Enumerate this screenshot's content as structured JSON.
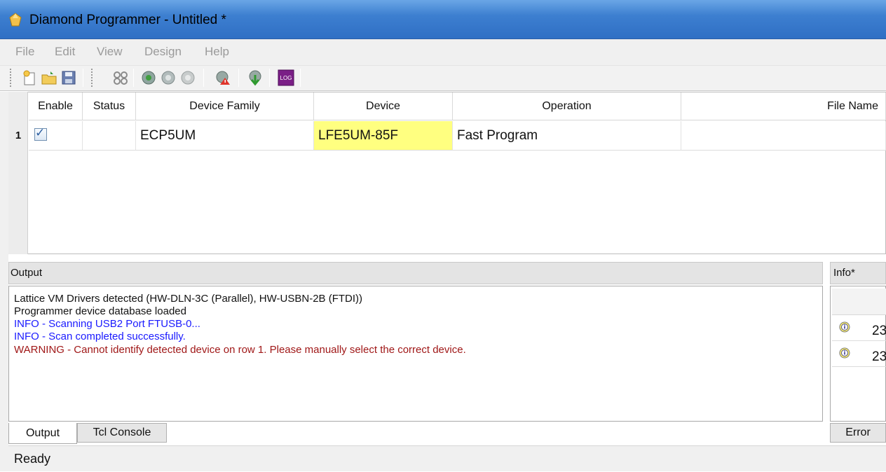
{
  "window": {
    "title": "Diamond Programmer - Untitled *"
  },
  "menu": {
    "items": [
      "File",
      "Edit",
      "View",
      "Design",
      "Help"
    ]
  },
  "toolbar": {
    "icons": [
      "new-project-icon",
      "open-project-icon",
      "save-icon",
      "scan-icon",
      "program-icon",
      "program-alt-icon",
      "program-disabled-icon",
      "cable-settings-icon",
      "download-icon",
      "log-icon"
    ],
    "log_label": "LOG"
  },
  "grid": {
    "columns": [
      "Enable",
      "Status",
      "Device Family",
      "Device",
      "Operation",
      "File Name"
    ],
    "rows": [
      {
        "num": "1",
        "enabled": true,
        "status": "",
        "family": "ECP5UM",
        "device": "LFE5UM-85F",
        "operation": "Fast Program",
        "file": ""
      }
    ]
  },
  "output": {
    "title": "Output",
    "lines": [
      {
        "text": "Lattice VM Drivers detected (HW-DLN-3C (Parallel), HW-USBN-2B (FTDI))",
        "level": "plain"
      },
      {
        "text": "Programmer device database loaded",
        "level": "plain"
      },
      {
        "text": "INFO - Scanning USB2 Port FTUSB-0...",
        "level": "info"
      },
      {
        "text": "INFO - Scan completed successfully.",
        "level": "info"
      },
      {
        "text": "WARNING - Cannot identify detected device on row 1. Please manually select the correct device.",
        "level": "warn"
      }
    ]
  },
  "tabs": {
    "output": "Output",
    "tcl": "Tcl Console"
  },
  "info": {
    "title": "Info*",
    "rows": [
      "23",
      "23"
    ],
    "tab_error": "Error"
  },
  "status": {
    "text": "Ready"
  },
  "colors": {
    "device_highlight": "#ffff80",
    "info_text": "#1a1aff",
    "warning_text": "#a01818"
  }
}
